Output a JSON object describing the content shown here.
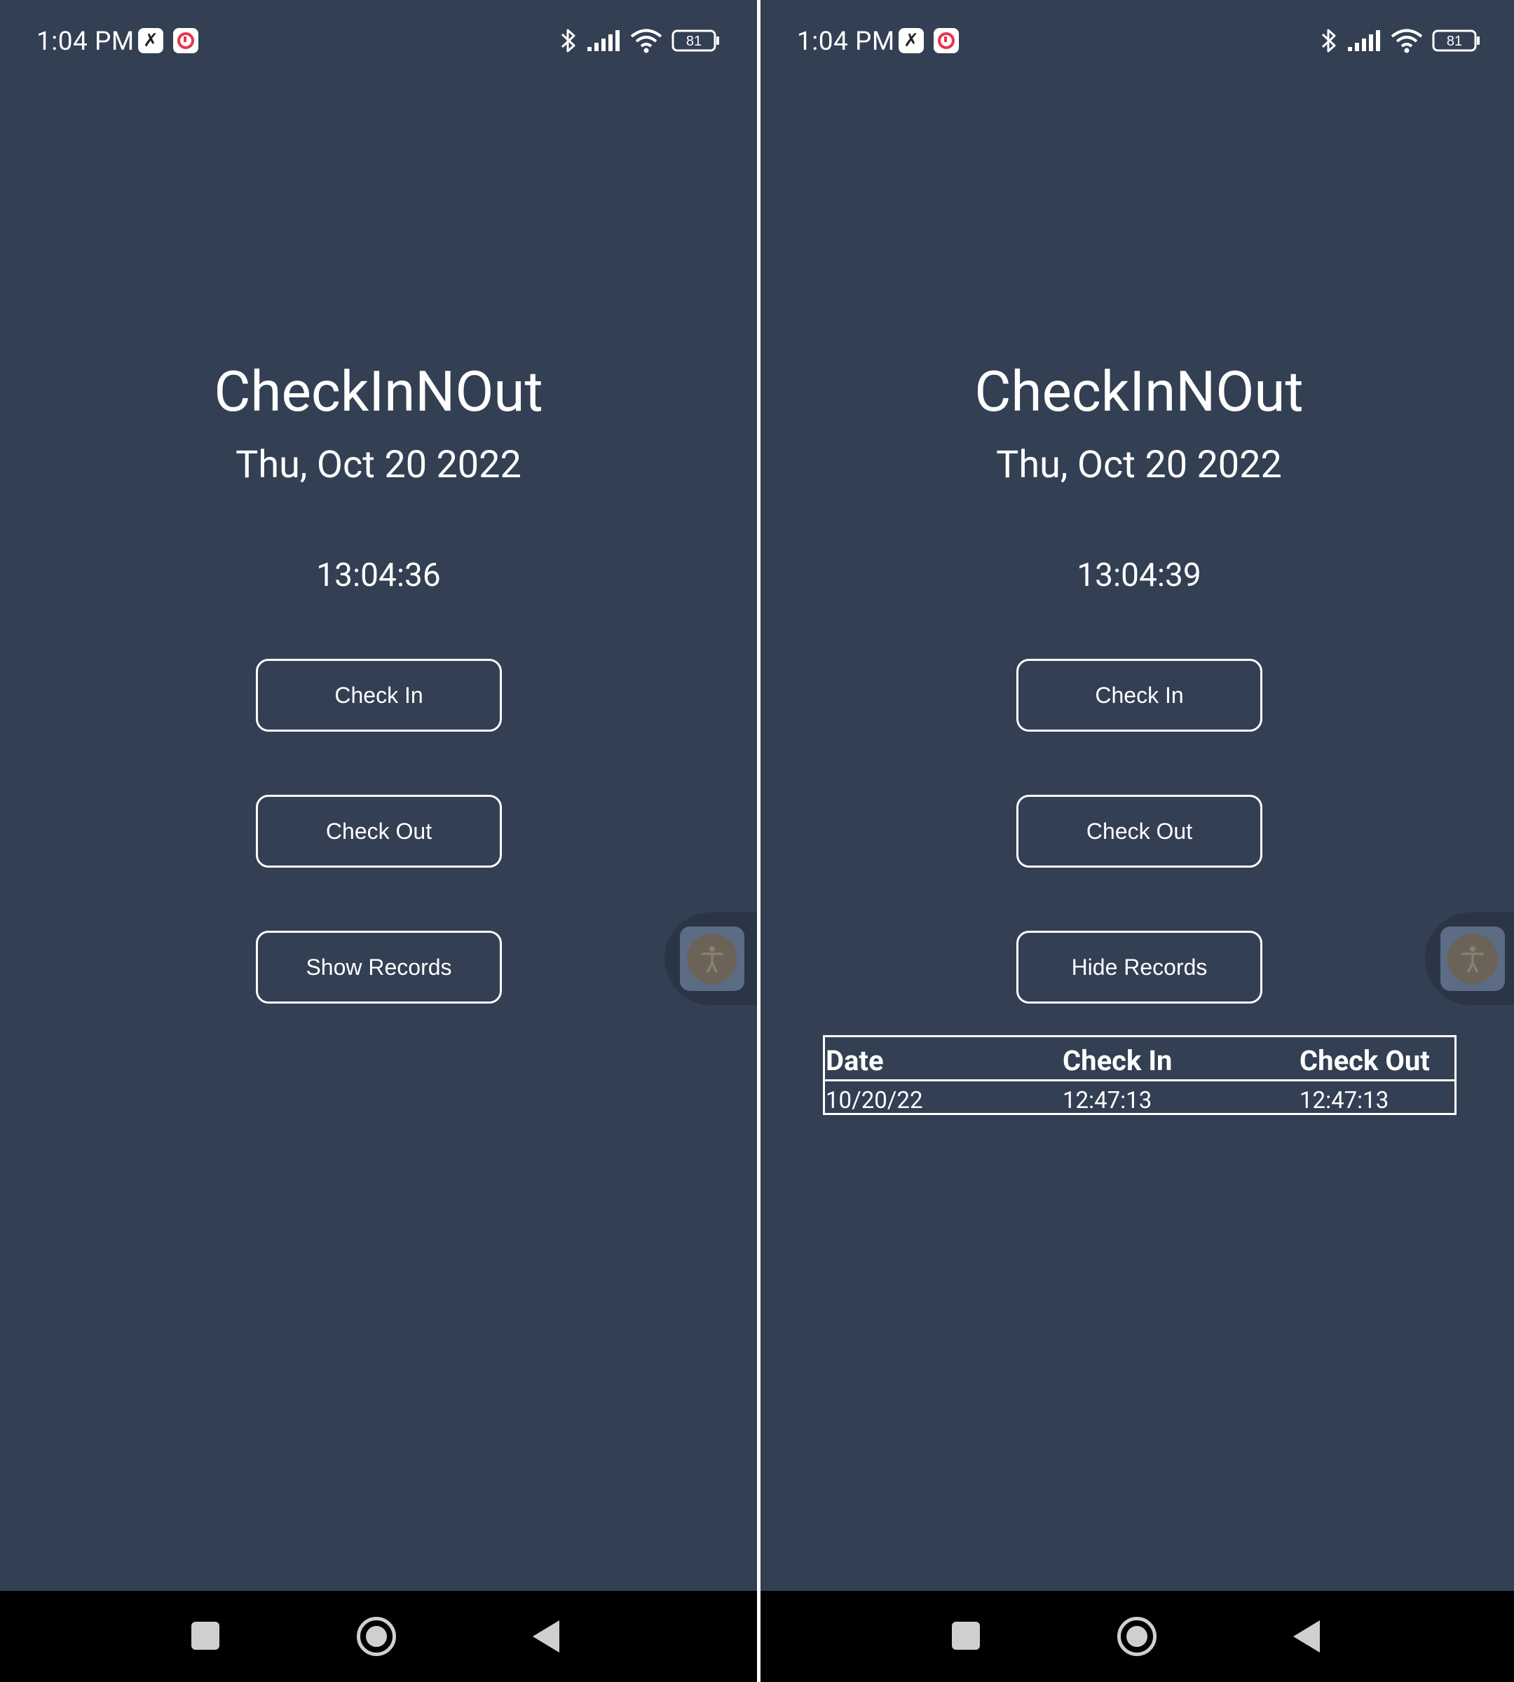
{
  "status_bar": {
    "time": "1:04 PM",
    "battery": "81",
    "icons": [
      "app-notification-icon",
      "alarm-app-icon",
      "bluetooth-icon",
      "signal-icon",
      "wifi-icon",
      "battery-icon"
    ]
  },
  "screens": [
    {
      "title": "CheckInNOut",
      "date": "Thu, Oct 20 2022",
      "clock": "13:04:36",
      "check_in_label": "Check In",
      "check_out_label": "Check Out",
      "records_toggle_label": "Show Records"
    },
    {
      "title": "CheckInNOut",
      "date": "Thu, Oct 20 2022",
      "clock": "13:04:39",
      "check_in_label": "Check In",
      "check_out_label": "Check Out",
      "records_toggle_label": "Hide Records",
      "records": {
        "headers": [
          "Date",
          "Check In",
          "Check Out"
        ],
        "rows": [
          [
            "10/20/22",
            "12:47:13",
            "12:47:13"
          ]
        ]
      }
    }
  ],
  "colors": {
    "background": "#333F52",
    "foreground": "#FFFFFF",
    "nav_bar": "#000000"
  }
}
